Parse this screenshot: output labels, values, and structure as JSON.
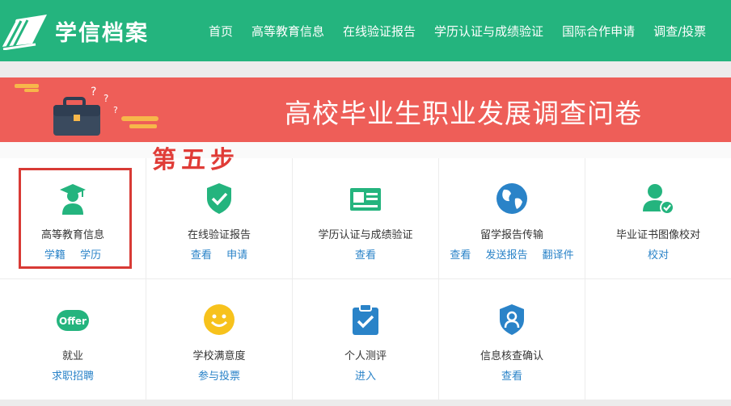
{
  "header": {
    "brand": "学信档案",
    "nav": [
      "首页",
      "高等教育信息",
      "在线验证报告",
      "学历认证与成绩验证",
      "国际合作申请",
      "调查/投票"
    ]
  },
  "banner": {
    "title": "高校毕业生职业发展调查问卷"
  },
  "annotation": {
    "step_label": "第五步"
  },
  "services": [
    {
      "title": "高等教育信息",
      "icon": "graduate-icon",
      "links": [
        "学籍",
        "学历"
      ]
    },
    {
      "title": "在线验证报告",
      "icon": "shield-check-icon",
      "links": [
        "查看",
        "申请"
      ]
    },
    {
      "title": "学历认证与成绩验证",
      "icon": "id-card-icon",
      "links": [
        "查看"
      ]
    },
    {
      "title": "留学报告传输",
      "icon": "globe-icon",
      "links": [
        "查看",
        "发送报告",
        "翻译件"
      ]
    },
    {
      "title": "毕业证书图像校对",
      "icon": "user-check-icon",
      "links": [
        "校对"
      ]
    },
    {
      "title": "就业",
      "icon": "offer-icon",
      "links": [
        "求职招聘"
      ]
    },
    {
      "title": "学校满意度",
      "icon": "smiley-icon",
      "links": [
        "参与投票"
      ]
    },
    {
      "title": "个人测评",
      "icon": "clipboard-check-icon",
      "links": [
        "进入"
      ]
    },
    {
      "title": "信息核查确认",
      "icon": "shield-user-icon",
      "links": [
        "查看"
      ]
    }
  ],
  "colors": {
    "brand_green": "#24b47e",
    "banner_red": "#ee5e58",
    "link_blue": "#2a83c8",
    "highlight_red": "#d83a35"
  }
}
